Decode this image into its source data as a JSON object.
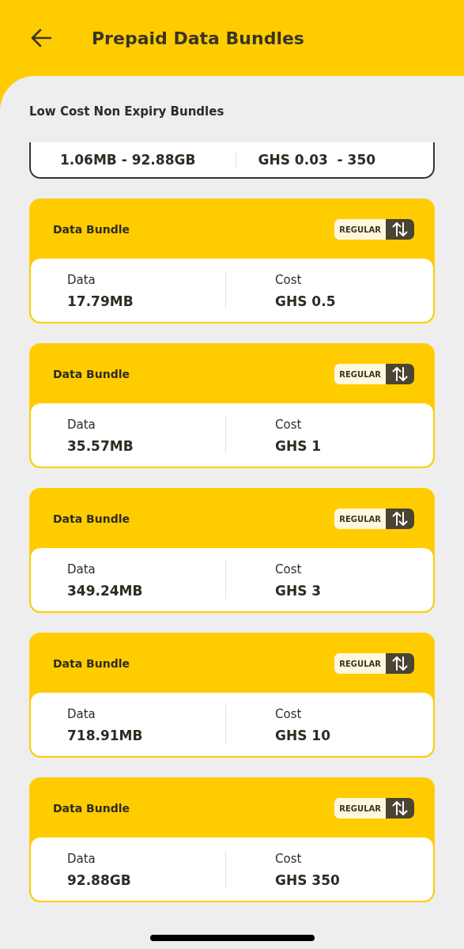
{
  "header": {
    "title": "Prepaid Data Bundles"
  },
  "section_title": "Low Cost Non Expiry Bundles",
  "summary_card": {
    "data": "1.06MB - 92.88GB",
    "cost": "GHS 0.03  - 350"
  },
  "bundles": [
    {
      "name": "Data Bundle",
      "badge": "REGULAR",
      "data_label": "Data",
      "data": "17.79MB",
      "cost_label": "Cost",
      "cost": "GHS 0.5"
    },
    {
      "name": "Data Bundle",
      "badge": "REGULAR",
      "data_label": "Data",
      "data": "35.57MB",
      "cost_label": "Cost",
      "cost": "GHS 1"
    },
    {
      "name": "Data Bundle",
      "badge": "REGULAR",
      "data_label": "Data",
      "data": "349.24MB",
      "cost_label": "Cost",
      "cost": "GHS 3"
    },
    {
      "name": "Data Bundle",
      "badge": "REGULAR",
      "data_label": "Data",
      "data": "718.91MB",
      "cost_label": "Cost",
      "cost": "GHS 10"
    },
    {
      "name": "Data Bundle",
      "badge": "REGULAR",
      "data_label": "Data",
      "data": "92.88GB",
      "cost_label": "Cost",
      "cost": "GHS 350"
    }
  ]
}
